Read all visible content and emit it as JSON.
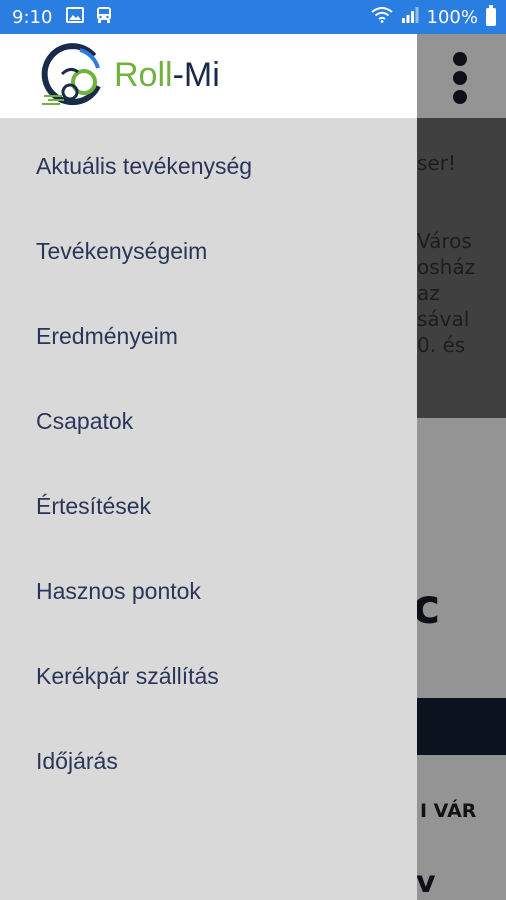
{
  "status_bar": {
    "time": "9:10",
    "icons_left": [
      "image-icon",
      "bus-icon"
    ],
    "icons_right": [
      "wifi-icon",
      "signal-icon"
    ],
    "battery": "100%"
  },
  "drawer": {
    "logo": {
      "word1": "Roll",
      "word2": "-Mi"
    },
    "menu_items": [
      "Aktuális tevékenység",
      "Tevékenységeim",
      "Eredményeim",
      "Csapatok",
      "Értesítések",
      "Hasznos pontok",
      "Kerékpár szállítás",
      "Időjárás"
    ]
  },
  "background": {
    "greeting_fragment": "ser!",
    "paragraph_fragments": [
      "Város",
      "osház",
      "az",
      "sával",
      "0. és"
    ],
    "big_letter": "c",
    "button_fragment": "I VÁR",
    "bottom_fragment": "v"
  },
  "colors": {
    "status_bar": "#2a7de1",
    "drawer_bg": "#d9d9d9",
    "menu_text": "#2b3558",
    "logo_green": "#6fb33e",
    "logo_navy": "#1a2a4a",
    "dark_bar": "#182036"
  }
}
